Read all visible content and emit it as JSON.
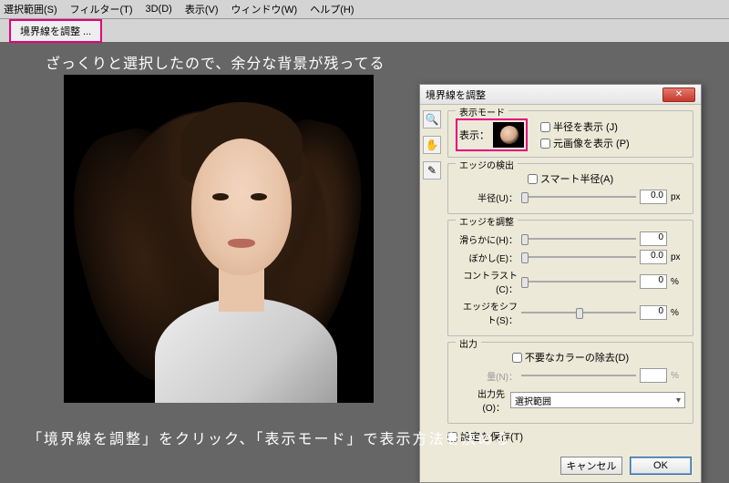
{
  "menu": [
    "選択範囲(S)",
    "フィルター(T)",
    "3D(D)",
    "表示(V)",
    "ウィンドウ(W)",
    "ヘルプ(H)"
  ],
  "toolbar": {
    "refine": "境界線を調整 ..."
  },
  "notes": {
    "top": "ざっくりと選択したので、余分な背景が残ってる",
    "bottom": "「境界線を調整」をクリック、「表示モード」で表示方法を決める"
  },
  "dialog": {
    "title": "境界線を調整",
    "viewMode": {
      "group": "表示モード",
      "viewLabel": "表示：",
      "showRadius": "半径を表示 (J)",
      "showOriginal": "元画像を表示 (P)"
    },
    "edgeDetect": {
      "group": "エッジの検出",
      "smart": "スマート半径(A)",
      "radius": "半径(U)：",
      "radiusVal": "0.0",
      "px": "px"
    },
    "adjust": {
      "group": "エッジを調整",
      "smooth": "滑らかに(H)：",
      "smoothVal": "0",
      "feather": "ぼかし(E)：",
      "featherVal": "0.0",
      "px": "px",
      "contrast": "コントラスト(C)：",
      "contrastVal": "0",
      "pct": "%",
      "shift": "エッジをシフト(S)：",
      "shiftVal": "0"
    },
    "output": {
      "group": "出力",
      "decon": "不要なカラーの除去(D)",
      "amount": "量(N)：",
      "amountVal": "",
      "pct": "%",
      "to": "出力先(O)：",
      "toVal": "選択範囲"
    },
    "remember": "設定を保存(T)",
    "cancel": "キャンセル",
    "ok": "OK"
  }
}
